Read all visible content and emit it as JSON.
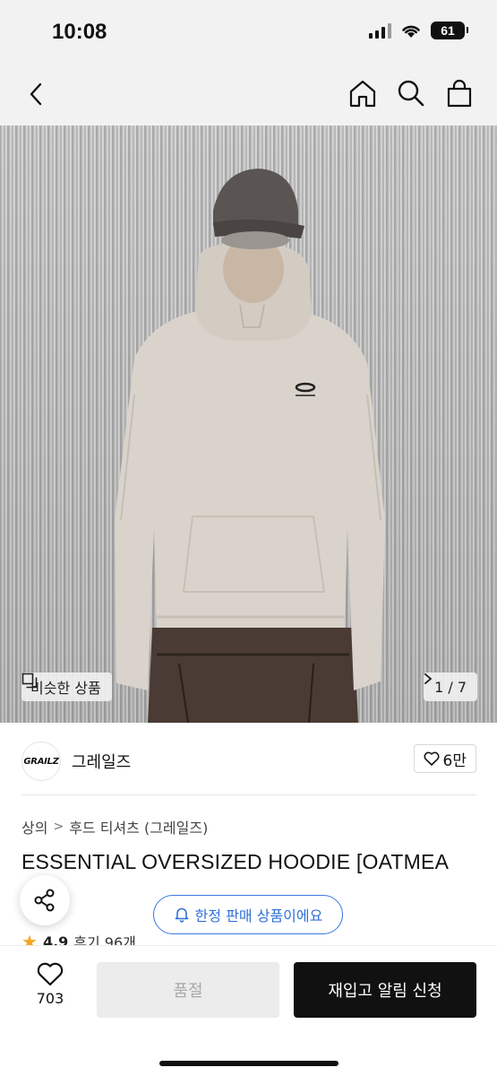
{
  "status_bar": {
    "time": "10:08",
    "battery": "61"
  },
  "nav": {
    "back_icon": "chevron-left-icon",
    "home_icon": "home-icon",
    "search_icon": "search-icon",
    "cart_icon": "shopping-bag-icon"
  },
  "hero": {
    "similar_label": "비슷한 상품",
    "page_indicator": "1 / 7"
  },
  "brand": {
    "logo_text": "GRAILZ",
    "name": "그레일즈",
    "like_count": "6만"
  },
  "breadcrumb": [
    "상의",
    "후드 티셔츠 (그레일즈)"
  ],
  "product": {
    "title": "ESSENTIAL OVERSIZED HOODIE [OATMEA",
    "rating": "4.9",
    "reviews": "후기 96개"
  },
  "limited_notice": "한정 판매 상품이에요",
  "bottom": {
    "wish_count": "703",
    "soldout_label": "품절",
    "restock_label": "재입고 알림 신청"
  },
  "colors": {
    "accent_blue": "#2f6fd8",
    "star": "#f5a623",
    "primary": "#111111"
  }
}
